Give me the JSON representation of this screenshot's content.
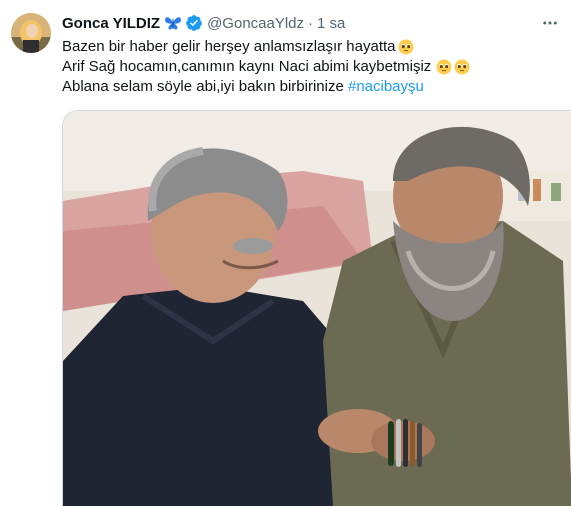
{
  "tweet": {
    "author_name": "Gonca YILDIZ",
    "author_handle": "@GoncaaYldz",
    "separator": "·",
    "time_ago": "1 sa",
    "line1": "Bazen bir haber gelir herşey anlamsızlaşır hayatta",
    "line2": "Arif Sağ hocamın,canımın kaynı Naci abimi kaybetmişiz",
    "line3_text": "Ablana selam söyle abi,iyi bakın birbirinize ",
    "hashtag": "#nacibayşu",
    "icons": {
      "name_badge": "butterfly-icon",
      "verified": "verified-badge-icon",
      "more": "more-options-icon",
      "emoji": "pleading-face-emoji"
    },
    "colors": {
      "hashtag": "#1d9bf0",
      "verified": "#1d9bf0",
      "butterfly": "#2b7de9",
      "secondary_text": "#536471"
    }
  }
}
